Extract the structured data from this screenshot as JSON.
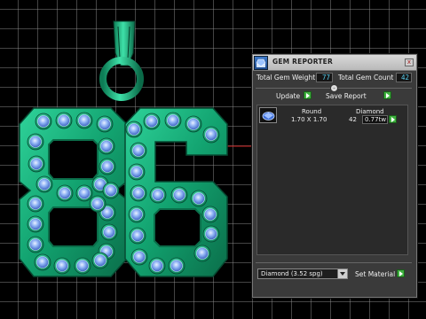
{
  "panel": {
    "title": "GEM REPORTER",
    "close_glyph": "x",
    "total_gem_weight_label": "Total Gem Weight",
    "total_gem_weight_value": "77",
    "total_gem_count_label": "Total Gem Count",
    "total_gem_count_value": "42",
    "collapse_glyph": "-",
    "update_label": "Update",
    "save_report_label": "Save Report",
    "table": {
      "columns": [
        "Round",
        "Diamond"
      ],
      "rows": [
        {
          "shape": "Round",
          "size": "1.70 X 1.70",
          "count": "42",
          "weight": "0.77tw",
          "material": "Diamond"
        }
      ]
    },
    "material_select_value": "Diamond  (3.52 spg)",
    "set_material_label": "Set Material"
  },
  "icons": {
    "panel_icon": "gem-reporter-icon",
    "close": "close-icon",
    "go": "green-arrow-icon",
    "gem_thumb": "round-gem-icon"
  },
  "colors": {
    "metal": "#1aa978",
    "gem": "#7fa6ee",
    "value_text": "#5ad0f0",
    "button_green": "#3fb13f"
  }
}
